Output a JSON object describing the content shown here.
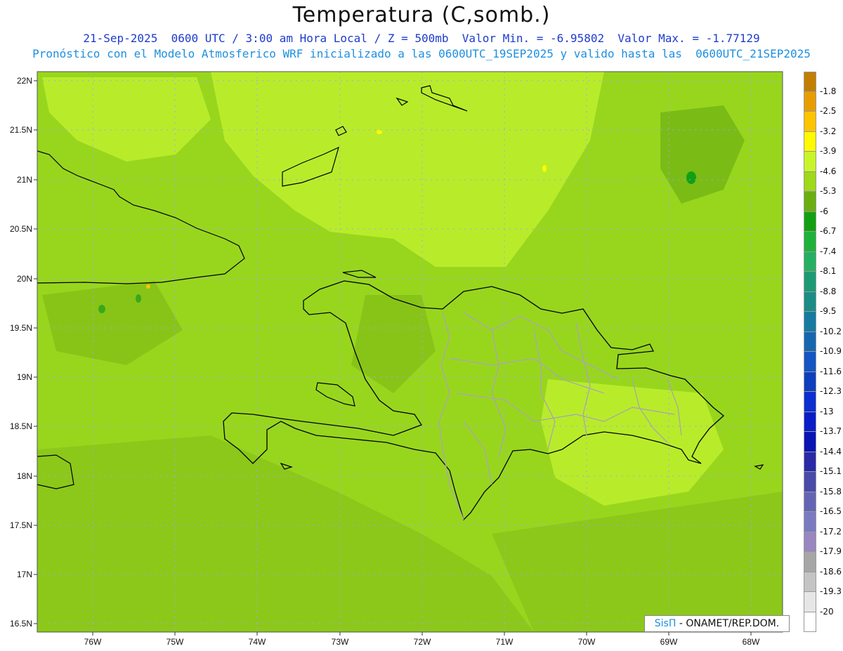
{
  "title": "Temperatura (C,somb.)",
  "subtitle_line1": "21-Sep-2025  0600 UTC / 3:00 am Hora Local / Z = 500mb  Valor Min. = -6.95802  Valor Max. = -1.77129",
  "subtitle_line2": "Pronóstico con el Modelo Atmosferico WRF inicializado a las 0600UTC_19SEP2025 y valido hasta las  0600UTC_21SEP2025",
  "credit": {
    "brand": "SisΠ",
    "text": " - ONAMET/REP.DOM."
  },
  "lat_labels": [
    "22N",
    "21.5N",
    "21N",
    "20.5N",
    "20N",
    "19.5N",
    "19N",
    "18.5N",
    "18N",
    "17.5N",
    "17N",
    "16.5N"
  ],
  "lon_labels": [
    "76W",
    "75W",
    "74W",
    "73W",
    "72W",
    "71W",
    "70W",
    "69W",
    "68W"
  ],
  "colorbar": {
    "labels": [
      "-1.8",
      "-2.5",
      "-3.2",
      "-3.9",
      "-4.6",
      "-5.3",
      "-6",
      "-6.7",
      "-7.4",
      "-8.1",
      "-8.8",
      "-9.5",
      "-10.2",
      "-10.9",
      "-11.6",
      "-12.3",
      "-13",
      "-13.7",
      "-14.4",
      "-15.1",
      "-15.8",
      "-16.5",
      "-17.2",
      "-17.9",
      "-18.6",
      "-19.3",
      "-20"
    ],
    "colors": [
      "#c27e00",
      "#e79d00",
      "#ffc400",
      "#fffa00",
      "#c8f52a",
      "#9ed91a",
      "#6aae12",
      "#12a012",
      "#1fb23a",
      "#24b060",
      "#1d9a74",
      "#1b8c86",
      "#177aa0",
      "#1667b0",
      "#1456c4",
      "#0e3fbe",
      "#0c2fd0",
      "#0a1ec8",
      "#0a14b4",
      "#2a2aa8",
      "#4a4aa8",
      "#6464b4",
      "#7a7ac0",
      "#9a86c0",
      "#a6a6a6",
      "#c4c4c4",
      "#e6e6e6",
      "#ffffff"
    ]
  },
  "colors": {
    "field_main": "#98d61e",
    "field_light": "#b8ec2a",
    "field_dark": "#6aae12",
    "coast": "#000000",
    "borders": "#a9a9a9",
    "grid": "#a0a0ff"
  }
}
